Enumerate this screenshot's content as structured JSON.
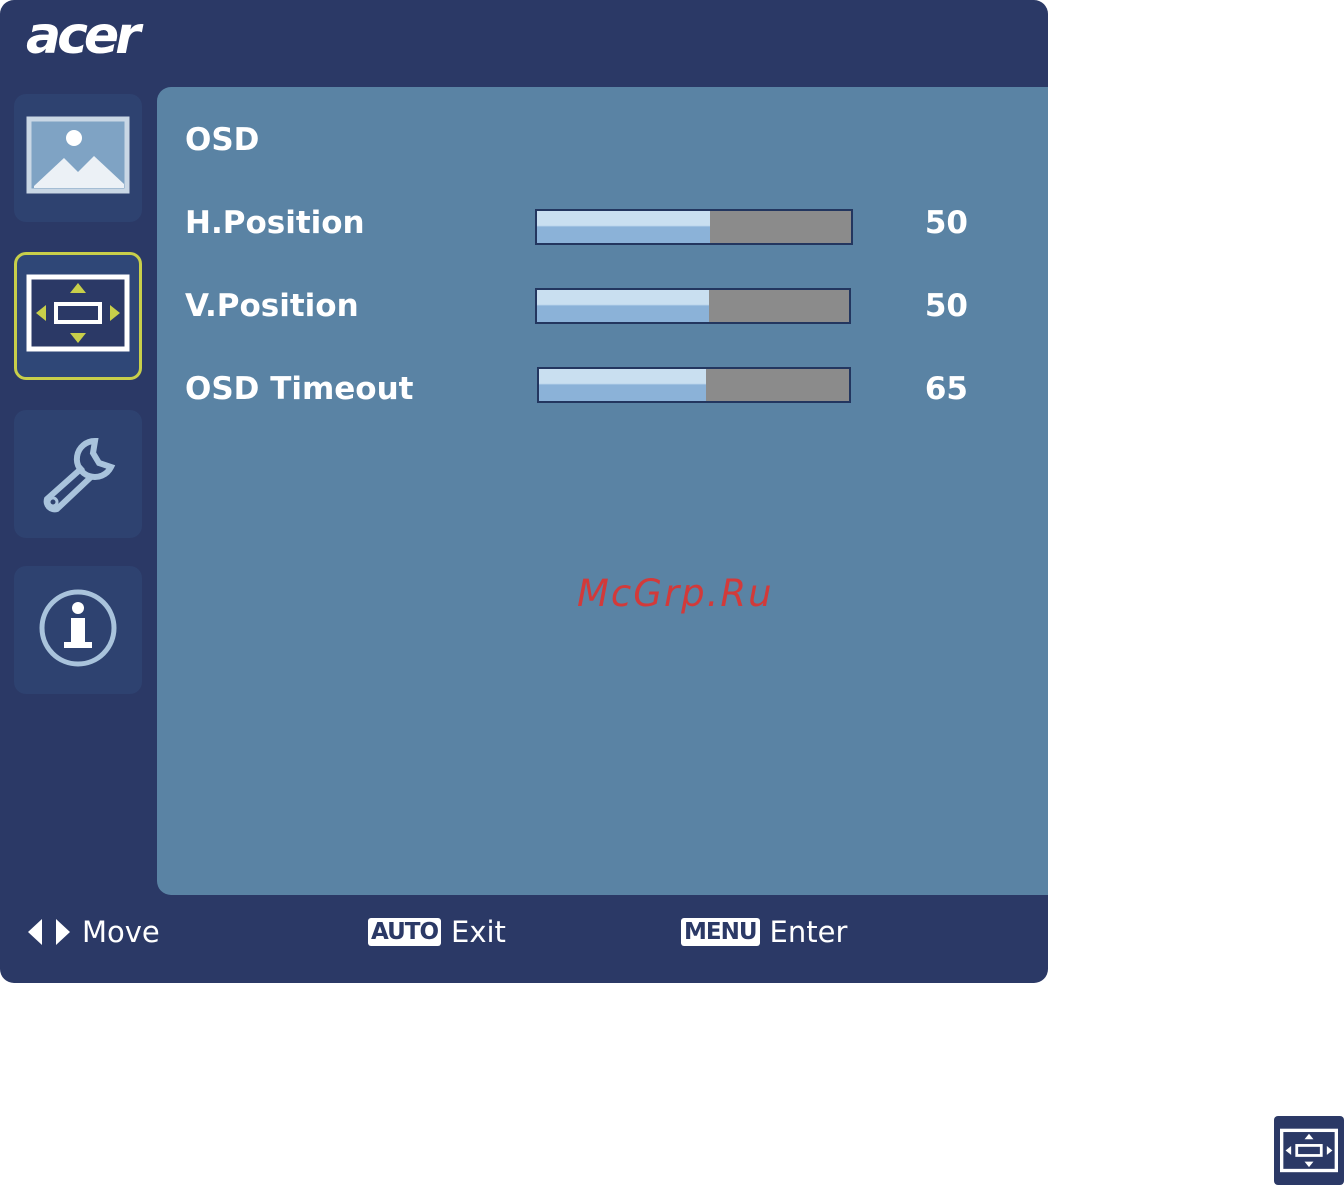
{
  "brand": {
    "logo_text": "acer"
  },
  "nav": {
    "items": [
      {
        "icon": "picture-icon",
        "selected": false
      },
      {
        "icon": "position-icon",
        "selected": true
      },
      {
        "icon": "wrench-icon",
        "selected": false
      },
      {
        "icon": "info-icon",
        "selected": false
      }
    ]
  },
  "panel": {
    "title": "OSD",
    "rows": [
      {
        "label": "H.Position",
        "value": "50",
        "level": 0.55
      },
      {
        "label": "V.Position",
        "value": "50",
        "level": 0.55
      },
      {
        "label": "OSD Timeout",
        "value": "65",
        "level": 0.54
      }
    ]
  },
  "watermark": "McGrp.Ru",
  "footer": {
    "move_label": "Move",
    "auto_key": "AUTO",
    "exit_label": "Exit",
    "menu_key": "MENU",
    "enter_label": "Enter"
  },
  "colors": {
    "frame": "#2b3966",
    "panel": "#5a83a4",
    "selected_border": "#c8cf4a",
    "slider_fill": "#8bb2d8",
    "slider_track": "#8b8b8b",
    "watermark": "#d23a3a"
  }
}
